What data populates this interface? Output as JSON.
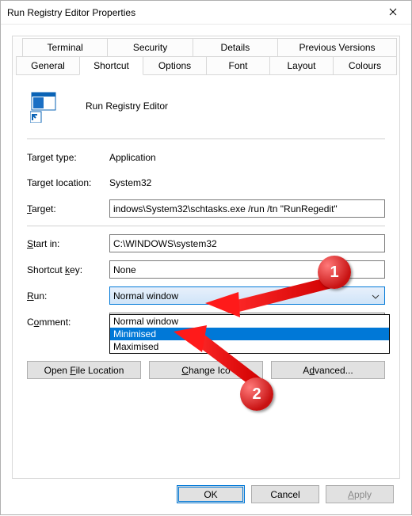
{
  "window": {
    "title": "Run Registry Editor Properties"
  },
  "tabs": {
    "row1": [
      "Terminal",
      "Security",
      "Details",
      "Previous Versions"
    ],
    "row2": [
      "General",
      "Shortcut",
      "Options",
      "Font",
      "Layout",
      "Colours"
    ],
    "active": "Shortcut"
  },
  "header": {
    "name": "Run Registry Editor"
  },
  "labels": {
    "target_type": "Target type:",
    "target_location": "Target location:",
    "target_t": "T",
    "target_rest": "arget:",
    "start_s": "S",
    "start_rest": "tart in:",
    "shortcut_pre": "Shortcut ",
    "shortcut_k": "k",
    "shortcut_post": "ey:",
    "run_r": "R",
    "run_rest": "un:",
    "comment_c": "C",
    "comment_o": "o",
    "comment_rest": "mment:"
  },
  "values": {
    "target_type": "Application",
    "target_location": "System32",
    "target": "indows\\System32\\schtasks.exe /run /tn \"RunRegedit\"",
    "start_in": "C:\\WINDOWS\\system32",
    "shortcut_key": "None",
    "run_selected": "Normal window",
    "run_options": [
      "Normal window",
      "Minimised",
      "Maximised"
    ],
    "comment": ""
  },
  "buttons": {
    "open_file_location_pre": "Open ",
    "open_file_location_u": "F",
    "open_file_location_post": "ile Location",
    "change_icon_u": "C",
    "change_icon_post": "hange Ico",
    "advanced_pre": "A",
    "advanced_u": "d",
    "advanced_post": "vanced..."
  },
  "dialog_buttons": {
    "ok": "OK",
    "cancel": "Cancel",
    "apply_a": "A",
    "apply_rest": "pply"
  },
  "annotations": {
    "badge1": "1",
    "badge2": "2"
  }
}
